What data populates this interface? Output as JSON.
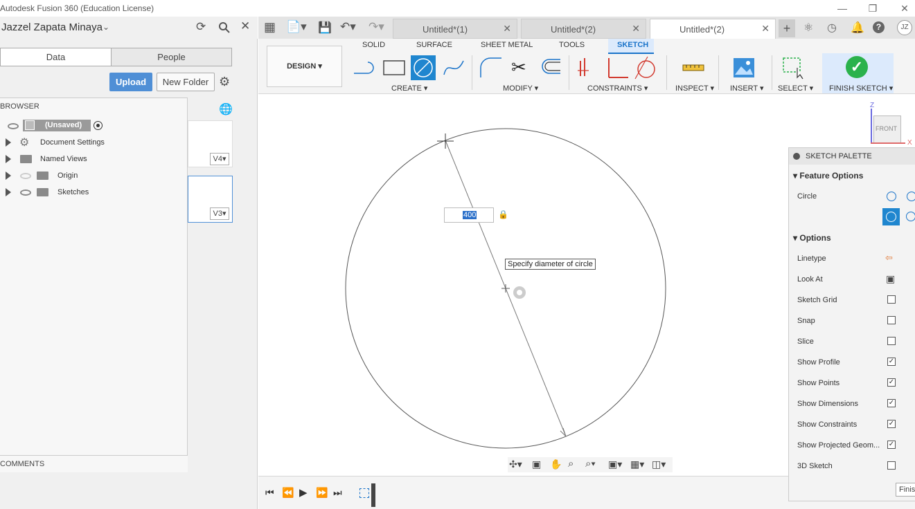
{
  "window": {
    "title": "Autodesk Fusion 360 (Education License)"
  },
  "data_panel": {
    "user_name": "Jazzel Zapata Minaya",
    "tabs": [
      "Data",
      "People"
    ],
    "upload_label": "Upload",
    "new_folder_label": "New Folder"
  },
  "browser": {
    "header": "BROWSER",
    "root_label": "(Unsaved)",
    "items": [
      {
        "label": "Document Settings",
        "icon": "gear-icon"
      },
      {
        "label": "Named Views",
        "icon": "folder-icon"
      },
      {
        "label": "Origin",
        "icon": "folder-icon"
      },
      {
        "label": "Sketches",
        "icon": "folder-icon"
      }
    ],
    "versions": [
      "V4",
      "V3"
    ],
    "comments_label": "COMMENTS"
  },
  "doc_tabs": [
    {
      "label": "Untitled*(1)",
      "active": false
    },
    {
      "label": "Untitled*(2)",
      "active": false
    },
    {
      "label": "Untitled*(2)",
      "active": true
    }
  ],
  "user_initials": "JZ",
  "toolbar": {
    "workspace": "DESIGN",
    "tabs": [
      "SOLID",
      "SURFACE",
      "SHEET METAL",
      "TOOLS",
      "SKETCH"
    ],
    "active_tab": "SKETCH",
    "groups": [
      "CREATE",
      "MODIFY",
      "CONSTRAINTS",
      "INSPECT",
      "INSERT",
      "SELECT",
      "FINISH SKETCH"
    ]
  },
  "canvas": {
    "dimension_value": "400",
    "tooltip": "Specify diameter of circle",
    "viewcube": {
      "face": "FRONT",
      "axis_z": "Z",
      "axis_x": "X"
    }
  },
  "sketch_palette": {
    "title": "SKETCH PALETTE",
    "feature_options_label": "Feature Options",
    "circle_label": "Circle",
    "options_label": "Options",
    "rows": [
      {
        "label": "Linetype",
        "type": "icon"
      },
      {
        "label": "Look At",
        "type": "icon"
      },
      {
        "label": "Sketch Grid",
        "checked": false
      },
      {
        "label": "Snap",
        "checked": false
      },
      {
        "label": "Slice",
        "checked": false
      },
      {
        "label": "Show Profile",
        "checked": true
      },
      {
        "label": "Show Points",
        "checked": true
      },
      {
        "label": "Show Dimensions",
        "checked": true
      },
      {
        "label": "Show Constraints",
        "checked": true
      },
      {
        "label": "Show Projected Geom...",
        "checked": true
      },
      {
        "label": "3D Sketch",
        "checked": false
      }
    ],
    "finish_label": "Finis"
  },
  "colors": {
    "accent": "#1a73c9",
    "finish_green": "#2bb24c",
    "upload_blue": "#4f8fd6"
  }
}
